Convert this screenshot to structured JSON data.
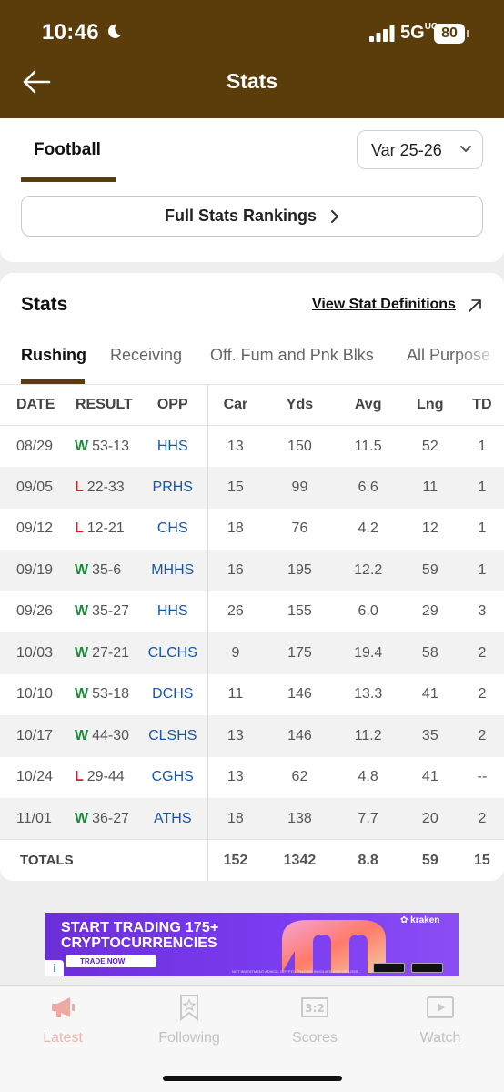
{
  "status_bar": {
    "time": "10:46",
    "network": "5G",
    "network_suffix": "UC",
    "battery": "80"
  },
  "header": {
    "title": "Stats"
  },
  "sport": {
    "tab": "Football",
    "season": "Var 25-26",
    "rankings_button": "Full Stats Rankings"
  },
  "stats": {
    "title": "Stats",
    "view_definitions": "View Stat Definitions",
    "tabs": [
      "Rushing",
      "Receiving",
      "Off. Fum and Pnk Blks",
      "All Purpose"
    ],
    "active_tab": "Rushing",
    "columns": [
      "DATE",
      "RESULT",
      "OPP",
      "Car",
      "Yds",
      "Avg",
      "Lng",
      "TD"
    ],
    "rows": [
      {
        "date": "08/29",
        "wl": "W",
        "score": "53-13",
        "opp": "HHS",
        "car": "13",
        "yds": "150",
        "avg": "11.5",
        "lng": "52",
        "td": "1"
      },
      {
        "date": "09/05",
        "wl": "L",
        "score": "22-33",
        "opp": "PRHS",
        "car": "15",
        "yds": "99",
        "avg": "6.6",
        "lng": "11",
        "td": "1"
      },
      {
        "date": "09/12",
        "wl": "L",
        "score": "12-21",
        "opp": "CHS",
        "car": "18",
        "yds": "76",
        "avg": "4.2",
        "lng": "12",
        "td": "1"
      },
      {
        "date": "09/19",
        "wl": "W",
        "score": "35-6",
        "opp": "MHHS",
        "car": "16",
        "yds": "195",
        "avg": "12.2",
        "lng": "59",
        "td": "1"
      },
      {
        "date": "09/26",
        "wl": "W",
        "score": "35-27",
        "opp": "HHS",
        "car": "26",
        "yds": "155",
        "avg": "6.0",
        "lng": "29",
        "td": "3"
      },
      {
        "date": "10/03",
        "wl": "W",
        "score": "27-21",
        "opp": "CLCHS",
        "car": "9",
        "yds": "175",
        "avg": "19.4",
        "lng": "58",
        "td": "2"
      },
      {
        "date": "10/10",
        "wl": "W",
        "score": "53-18",
        "opp": "DCHS",
        "car": "11",
        "yds": "146",
        "avg": "13.3",
        "lng": "41",
        "td": "2"
      },
      {
        "date": "10/17",
        "wl": "W",
        "score": "44-30",
        "opp": "CLSHS",
        "car": "13",
        "yds": "146",
        "avg": "11.2",
        "lng": "35",
        "td": "2"
      },
      {
        "date": "10/24",
        "wl": "L",
        "score": "29-44",
        "opp": "CGHS",
        "car": "13",
        "yds": "62",
        "avg": "4.8",
        "lng": "41",
        "td": "--"
      },
      {
        "date": "11/01",
        "wl": "W",
        "score": "36-27",
        "opp": "ATHS",
        "car": "18",
        "yds": "138",
        "avg": "7.7",
        "lng": "20",
        "td": "2"
      }
    ],
    "totals": {
      "label": "TOTALS",
      "car": "152",
      "yds": "1342",
      "avg": "8.8",
      "lng": "59",
      "td": "15"
    }
  },
  "ad": {
    "line1": "START TRADING 175+",
    "line2": "CRYPTOCURRENCIES",
    "cta": "TRADE NOW",
    "brand": "kraken",
    "info": "i",
    "fine_print": "NOT INVESTMENT ADVICE. CRYPTO TRADING INVOLVES RISK OF LOSS."
  },
  "bottom_nav": [
    {
      "label": "Latest",
      "icon": "megaphone-icon",
      "active": true
    },
    {
      "label": "Following",
      "icon": "bookmark-star-icon",
      "active": false
    },
    {
      "label": "Scores",
      "icon": "scoreboard-icon",
      "active": false
    },
    {
      "label": "Watch",
      "icon": "play-icon",
      "active": false
    }
  ],
  "colors": {
    "brand": "#5a3d0b",
    "win": "#1e8a3a",
    "loss": "#d0202a",
    "link": "#1a55a6"
  }
}
